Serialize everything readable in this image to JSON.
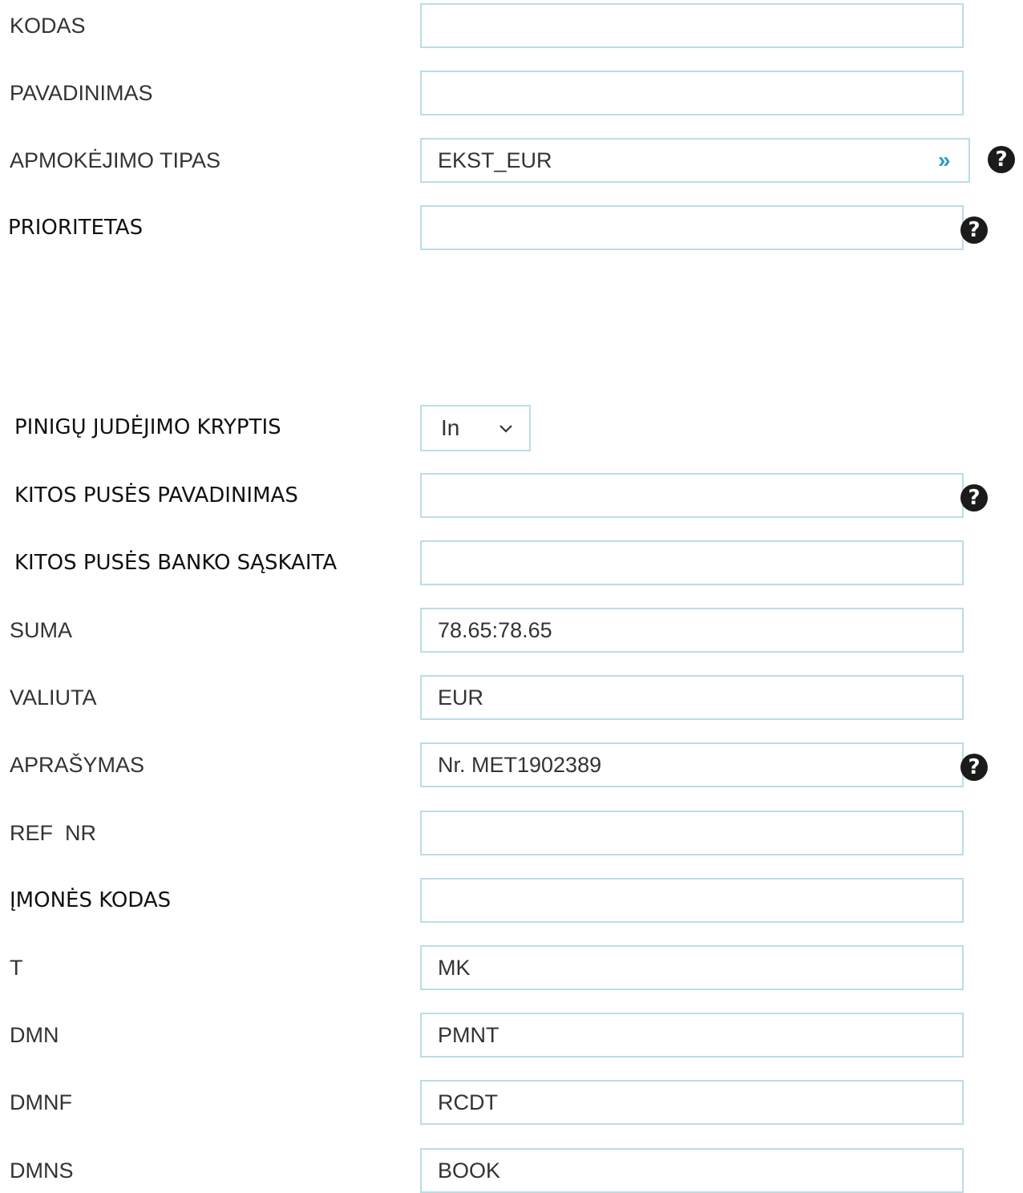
{
  "fields": [
    {
      "key": "kodas",
      "label": "KODAS",
      "value": ""
    },
    {
      "key": "pavadinimas",
      "label": "PAVADINIMAS",
      "value": ""
    },
    {
      "key": "apmokejimo_tipas",
      "label": "APMOKĖJIMO TIPAS",
      "value": "EKST_EUR",
      "lookup_icon": "double-chevron-right-icon",
      "help": true
    },
    {
      "key": "prioritetas",
      "label": "PRIORITETAS",
      "value": "",
      "help": true
    },
    {
      "key": "pinigu_judejimo_kryptis",
      "label": "PINIGŲ JUDĖJIMO KRYPTIS",
      "type": "select",
      "value": "In"
    },
    {
      "key": "kitos_puses_pavadinimas",
      "label": "KITOS PUSĖS PAVADINIMAS",
      "value": "",
      "help": true
    },
    {
      "key": "kitos_puses_banko_saskaita",
      "label": "KITOS PUSĖS BANKO SĄSKAITA",
      "value": ""
    },
    {
      "key": "suma",
      "label": "SUMA",
      "value": "78.65:78.65"
    },
    {
      "key": "valiuta",
      "label": "VALIUTA",
      "value": "EUR"
    },
    {
      "key": "aprasymas",
      "label": "APRAŠYMAS",
      "value": "Nr. MET1902389",
      "help": true
    },
    {
      "key": "ref_nr",
      "label": "REF  NR",
      "value": ""
    },
    {
      "key": "imones_kodas",
      "label": "ĮMONĖS KODAS",
      "value": ""
    },
    {
      "key": "t",
      "label": "T",
      "value": "MK"
    },
    {
      "key": "dmn",
      "label": "DMN",
      "value": "PMNT"
    },
    {
      "key": "dmnf",
      "label": "DMNF",
      "value": "RCDT"
    },
    {
      "key": "dmns",
      "label": "DMNS",
      "value": "BOOK"
    }
  ],
  "icons": {
    "help": "question-circle-icon",
    "lookup": "double-chevron-right-icon",
    "dropdown": "chevron-down-icon"
  },
  "symbols": {
    "help": "?",
    "lookup": "»"
  },
  "colors": {
    "field_border": "#b9dde6",
    "lookup_chevron": "#2a9dc0",
    "help_icon": "#1b1b1b",
    "label": "#333333"
  }
}
